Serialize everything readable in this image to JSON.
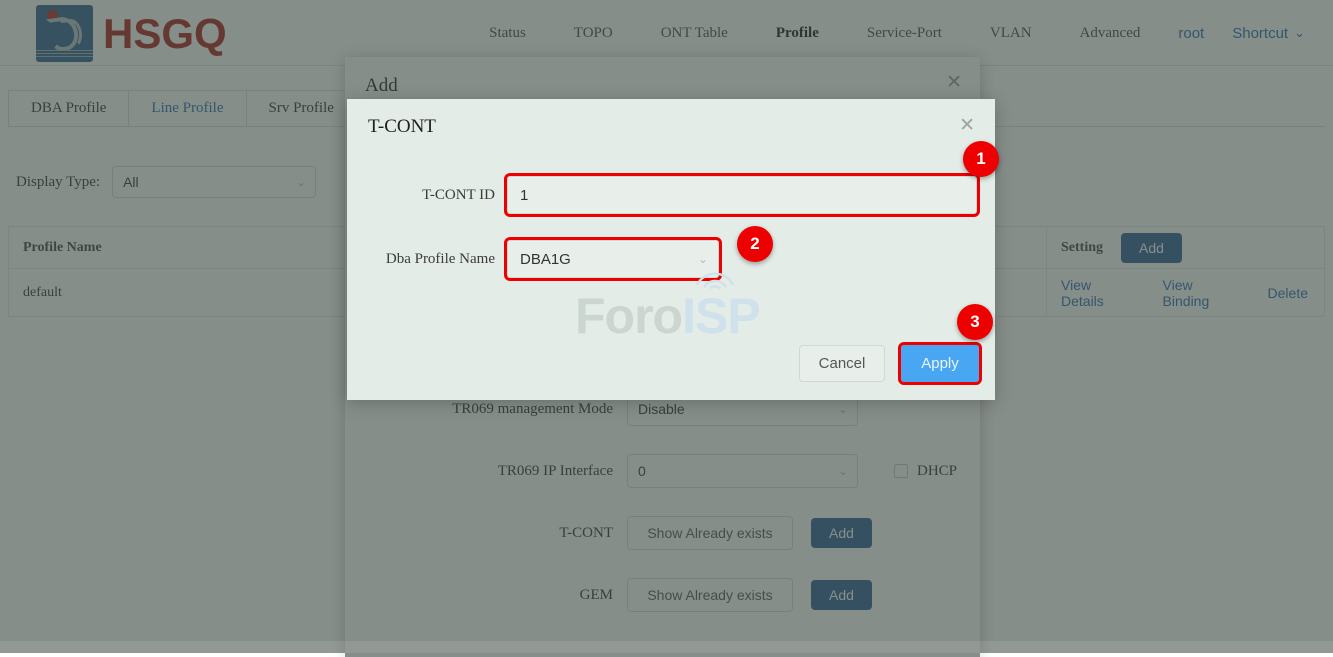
{
  "header": {
    "brand": "HSGQ",
    "logo_icon": "hsgq-logo-icon",
    "nav": [
      {
        "label": "Status",
        "active": false
      },
      {
        "label": "TOPO",
        "active": false
      },
      {
        "label": "ONT Table",
        "active": false
      },
      {
        "label": "Profile",
        "active": true
      },
      {
        "label": "Service-Port",
        "active": false
      },
      {
        "label": "VLAN",
        "active": false
      },
      {
        "label": "Advanced",
        "active": false
      }
    ],
    "user": "root",
    "shortcut": "Shortcut",
    "shortcut_caret": "⌄"
  },
  "tabs": [
    {
      "label": "DBA Profile",
      "active": false
    },
    {
      "label": "Line Profile",
      "active": true
    },
    {
      "label": "Srv Profile",
      "active": false
    }
  ],
  "filter": {
    "label": "Display Type:",
    "value": "All",
    "caret": "⌄"
  },
  "table": {
    "columns": [
      "Profile Name",
      "Setting"
    ],
    "header_add_button": "Add",
    "rows": [
      {
        "profile_name": "default",
        "actions": [
          "View Details",
          "View Binding",
          "Delete"
        ]
      }
    ]
  },
  "add_modal": {
    "title": "Add",
    "close": "✕",
    "fields": [
      {
        "label": "TR069 management Mode",
        "type": "select",
        "value": "Disable",
        "caret": "⌄"
      },
      {
        "label": "TR069 IP Interface",
        "type": "select",
        "value": "0",
        "caret": "⌄",
        "checkbox_label": "DHCP"
      },
      {
        "label": "T-CONT",
        "type": "button",
        "value": "Show Already exists",
        "add_label": "Add"
      },
      {
        "label": "GEM",
        "type": "button",
        "value": "Show Already exists",
        "add_label": "Add"
      }
    ]
  },
  "tcont_modal": {
    "title": "T-CONT",
    "close": "✕",
    "tcont_id_label": "T-CONT ID",
    "tcont_id_value": "1",
    "dba_label": "Dba Profile Name",
    "dba_value": "DBA1G",
    "dba_caret": "⌄",
    "cancel_label": "Cancel",
    "apply_label": "Apply"
  },
  "watermark": {
    "part1": "Foro",
    "part2": "ISP"
  },
  "badges": [
    {
      "number": "1"
    },
    {
      "number": "2"
    },
    {
      "number": "3"
    }
  ],
  "colors": {
    "brand_red": "#a8201a",
    "logo_blue": "#2f5f8f",
    "link_blue": "#2b6cb0",
    "button_blue": "#2b5f94",
    "apply_blue": "#49a6f2",
    "badge_red": "#ee0000",
    "highlight_red": "#ee0000",
    "modal_bg": "#e3ece7"
  }
}
